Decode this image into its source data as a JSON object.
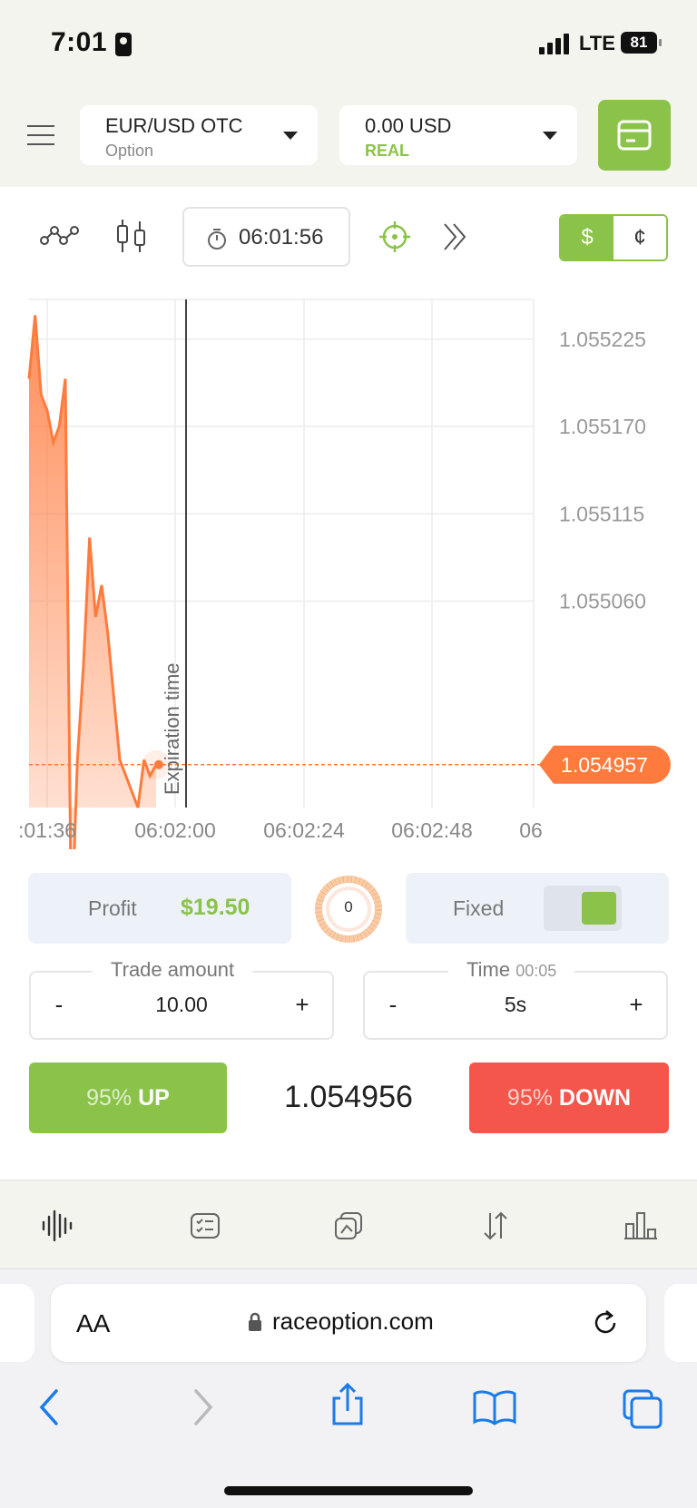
{
  "status_bar": {
    "time": "7:01",
    "network": "LTE",
    "battery": "81"
  },
  "header": {
    "asset": {
      "name": "EUR/USD OTC",
      "type": "Option"
    },
    "account": {
      "balance": "0.00 USD",
      "mode": "REAL"
    }
  },
  "toolbar": {
    "timer": "06:01:56",
    "currency": {
      "dollar": "$",
      "cent": "¢",
      "selected": "$"
    }
  },
  "chart_data": {
    "type": "area",
    "title": "",
    "y_ticks": [
      "1.055225",
      "1.055170",
      "1.055115",
      "1.055060"
    ],
    "x_ticks": [
      ":01:36",
      "06:02:00",
      "06:02:24",
      "06:02:48",
      "06"
    ],
    "current_price_label": "1.054957",
    "expiration_label": "Expiration time",
    "ylim": [
      1.05493,
      1.05525
    ],
    "series": [
      {
        "x": [
          "06:01:36",
          "06:01:37",
          "06:01:38",
          "06:01:39",
          "06:01:40",
          "06:01:41",
          "06:01:42",
          "06:01:43",
          "06:01:44",
          "06:01:45",
          "06:01:46",
          "06:01:47",
          "06:01:48",
          "06:01:49",
          "06:01:50",
          "06:01:51",
          "06:01:52",
          "06:01:53",
          "06:01:54",
          "06:01:55",
          "06:01:56",
          "06:01:57"
        ],
        "values": [
          1.0552,
          1.05524,
          1.05519,
          1.05518,
          1.05516,
          1.05517,
          1.0552,
          1.05485,
          1.05496,
          1.05502,
          1.0551,
          1.05505,
          1.05507,
          1.05504,
          1.055,
          1.05496,
          1.05495,
          1.05494,
          1.05493,
          1.05496,
          1.05495,
          1.054957
        ]
      }
    ],
    "colors": {
      "line": "#ff7a3d",
      "price_tag": "#ff7a3d"
    },
    "grid": true
  },
  "trade": {
    "profit_label": "Profit",
    "profit_value": "$19.50",
    "gauge_value": "0",
    "fixed_label": "Fixed",
    "fixed_on": true,
    "amount_label": "Trade amount",
    "amount_value": "10.00",
    "time_label": "Time",
    "time_sub": "00:05",
    "time_value": "5s",
    "minus": "-",
    "plus": "+",
    "up_pct": "95%",
    "up_label": "UP",
    "down_pct": "95%",
    "down_label": "DOWN",
    "current_price": "1.054956",
    "colors": {
      "up": "#8bc34a",
      "down": "#f4564b"
    }
  },
  "app_nav": [
    "waveform-icon",
    "checklist-icon",
    "copy-icon",
    "sort-arrows-icon",
    "bar-chart-icon"
  ],
  "safari": {
    "aa": "AA",
    "url": "raceoption.com"
  }
}
